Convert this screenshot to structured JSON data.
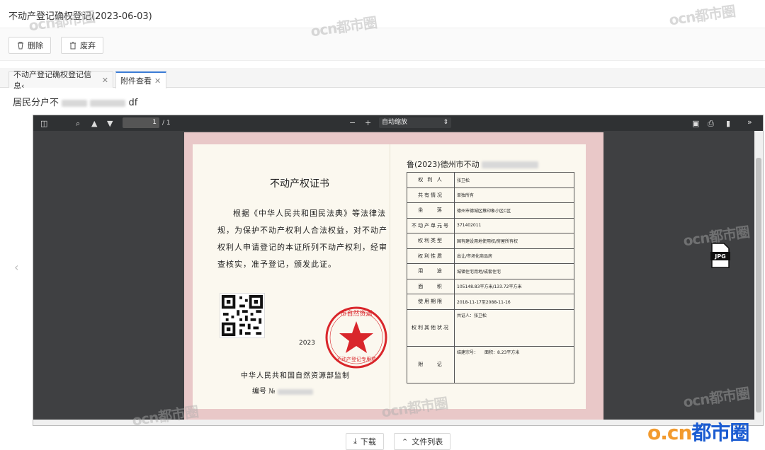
{
  "page": {
    "title": "不动产登记确权登记(2023-06-03)"
  },
  "toolbar": {
    "delete_label": "删除",
    "discard_label": "废弃"
  },
  "tabs": [
    {
      "label": "不动产登记确权登记信息‹"
    },
    {
      "label": "附件查看"
    }
  ],
  "attachment": {
    "filename_prefix": "居民分户不",
    "filename_suffix": "df"
  },
  "viewer": {
    "page_number": "1",
    "page_count": "/ 1",
    "zoom_selected": "自动缩放",
    "zoom_minus": "−",
    "zoom_plus": "+",
    "more": "»"
  },
  "certificate": {
    "title": "不动产权证书",
    "body": "根据《中华人民共和国民法典》等法律法规，为保护不动产权利人合法权益，对不动产权利人申请登记的本证所列不动产权利，经审查核实，准予登记，颁发此证。",
    "year": "2023",
    "seal_text": "不动产登记专用章",
    "seal_top": "市自然资源",
    "supervisor": "中华人民共和国自然资源部监制",
    "number_label": "编号 №",
    "cert_no_prefix": "鲁(2023)德州市不动",
    "rows": [
      {
        "key": "权 利 人",
        "value": "张卫松"
      },
      {
        "key": "共有情况",
        "value": "单独所有"
      },
      {
        "key": "坐 　 落",
        "value": "德州市德城区蔡印象小区C区"
      },
      {
        "key": "不动产单元号",
        "value": "371402011"
      },
      {
        "key": "权利类型",
        "value": "国有建设用地使用权/房屋所有权"
      },
      {
        "key": "权利性质",
        "value": "出让/市场化商品房"
      },
      {
        "key": "用 　 途",
        "value": "城镇住宅用地/成套住宅"
      },
      {
        "key": "面 　 积",
        "value": "105148.83平方米/133.72平方米"
      },
      {
        "key": "使用期限",
        "value": "2018-11-17至2088-11-16"
      },
      {
        "key": "权利其他状况",
        "value": "共证人：张卫松"
      },
      {
        "key": "附 　 记",
        "value": "结建宗号：　　面积：8.23平方米"
      }
    ]
  },
  "bottom": {
    "download_label": "下载",
    "file_list_label": "文件列表"
  },
  "watermark": {
    "text": "ocn都市圈",
    "logo_o": "o.cn",
    "logo_rest": "都市圈"
  },
  "icons": {
    "jpg": "JPG"
  }
}
